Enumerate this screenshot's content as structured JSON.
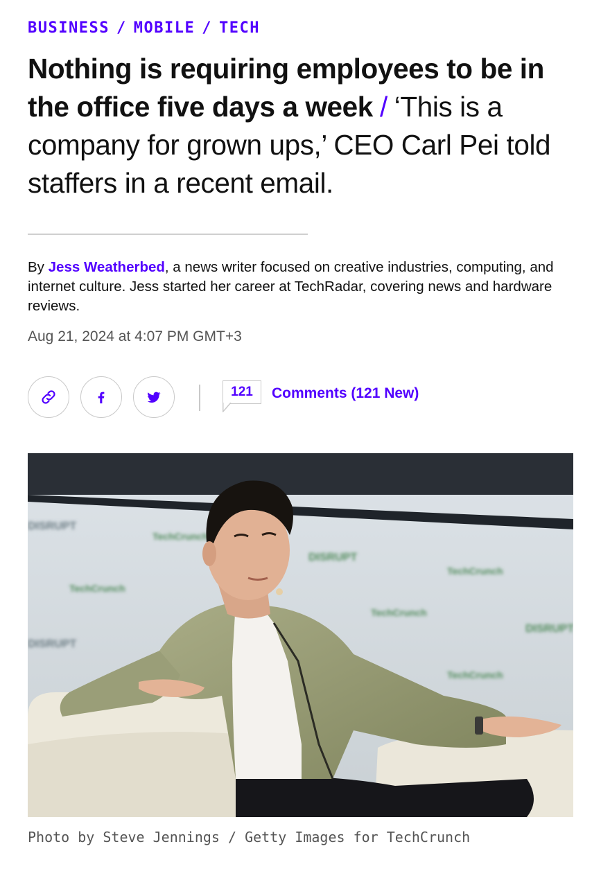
{
  "breadcrumb": [
    {
      "label": "BUSINESS"
    },
    {
      "label": "MOBILE"
    },
    {
      "label": "TECH"
    }
  ],
  "breadcrumb_separator": "/",
  "headline": {
    "title": "Nothing is requiring employees to be in the office five days a week",
    "separator": "/",
    "dek": "‘This is a company for grown ups,’ CEO Carl Pei told staffers in a recent email."
  },
  "byline": {
    "prefix": "By",
    "author": "Jess Weatherbed",
    "bio": ", a news writer focused on creative industries, computing, and internet culture. Jess started her career at TechRadar, covering news and hardware reviews."
  },
  "timestamp": "Aug 21, 2024 at 4:07 PM GMT+3",
  "share": {
    "buttons": [
      {
        "icon": "link-icon"
      },
      {
        "icon": "facebook-icon"
      },
      {
        "icon": "twitter-icon"
      }
    ],
    "comment_count": "121",
    "comments_label": "Comments (121 New)"
  },
  "photo": {
    "backdrop_text": [
      "DISRUPT",
      "TechCrunch"
    ]
  },
  "caption": "Photo by Steve Jennings / Getty Images for TechCrunch",
  "colors": {
    "accent": "#5200ff",
    "text": "#111111",
    "muted": "#555555",
    "border": "#c9c9c9"
  }
}
